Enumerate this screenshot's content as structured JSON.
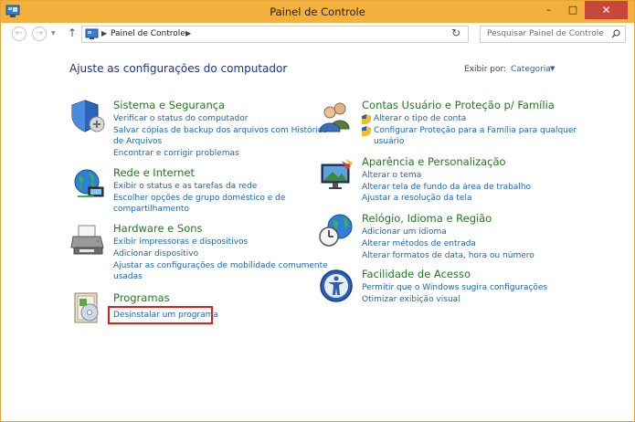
{
  "window": {
    "title": "Painel de Controle",
    "minimize_glyph": "–",
    "maximize_glyph": "□",
    "close_glyph": "✕"
  },
  "nav": {
    "back_glyph": "←",
    "forward_glyph": "→",
    "history_glyph": "▼",
    "up_glyph": "↑",
    "address_sep": "▶",
    "address_path": "Painel de Controle",
    "refresh_glyph": "↻",
    "search_placeholder": "Pesquisar Painel de Controle"
  },
  "header": {
    "title": "Ajuste as configurações do computador",
    "view_by_label": "Exibir por:",
    "view_by_value": "Categoria",
    "view_by_arrow": "▼"
  },
  "categories": [
    {
      "icon": "shield-security-icon",
      "title": "Sistema e Segurança",
      "links": [
        "Verificar o status do computador",
        "Salvar cópias de backup dos arquivos com Histórico",
        "de Arquivos",
        "Encontrar e corrigir problemas"
      ]
    },
    {
      "icon": "network-globe-icon",
      "title": "Rede e Internet",
      "links": [
        "Exibir o status e as tarefas da rede",
        "Escolher opções de grupo doméstico e de",
        "compartilhamento"
      ]
    },
    {
      "icon": "printer-icon",
      "title": "Hardware e Sons",
      "links": [
        "Exibir impressoras e dispositivos",
        "Adicionar dispositivo",
        "Ajustar as configurações de mobilidade comumente",
        "usadas"
      ]
    },
    {
      "icon": "programs-icon",
      "title": "Programas",
      "links": [
        "Desinstalar um programa"
      ]
    },
    {
      "icon": "users-icon",
      "title": "Contas Usuário e Proteção p/ Família",
      "links": [
        "Alterar o tipo de conta",
        "Configurar Proteção para a Família para qualquer",
        "usuário"
      ]
    },
    {
      "icon": "appearance-icon",
      "title": "Aparência e Personalização",
      "links": [
        "Alterar o tema",
        "Alterar tela de fundo da área de trabalho",
        "Ajustar a resolução da tela"
      ]
    },
    {
      "icon": "clock-globe-icon",
      "title": "Relógio, Idioma e Região",
      "links": [
        "Adicionar um idioma",
        "Alterar métodos de entrada",
        "Alterar formatos de data, hora ou número"
      ]
    },
    {
      "icon": "ease-of-access-icon",
      "title": "Facilidade de Acesso",
      "links": [
        "Permitir que o Windows sugira configurações",
        "Otimizar exibição visual"
      ]
    }
  ],
  "colors": {
    "titlebar": "#f3b13c",
    "link": "#1e64b4",
    "category_title": "#1e7a1e",
    "heading": "#1e3287",
    "highlight": "#e21b1b",
    "close_button": "#c7483a"
  }
}
